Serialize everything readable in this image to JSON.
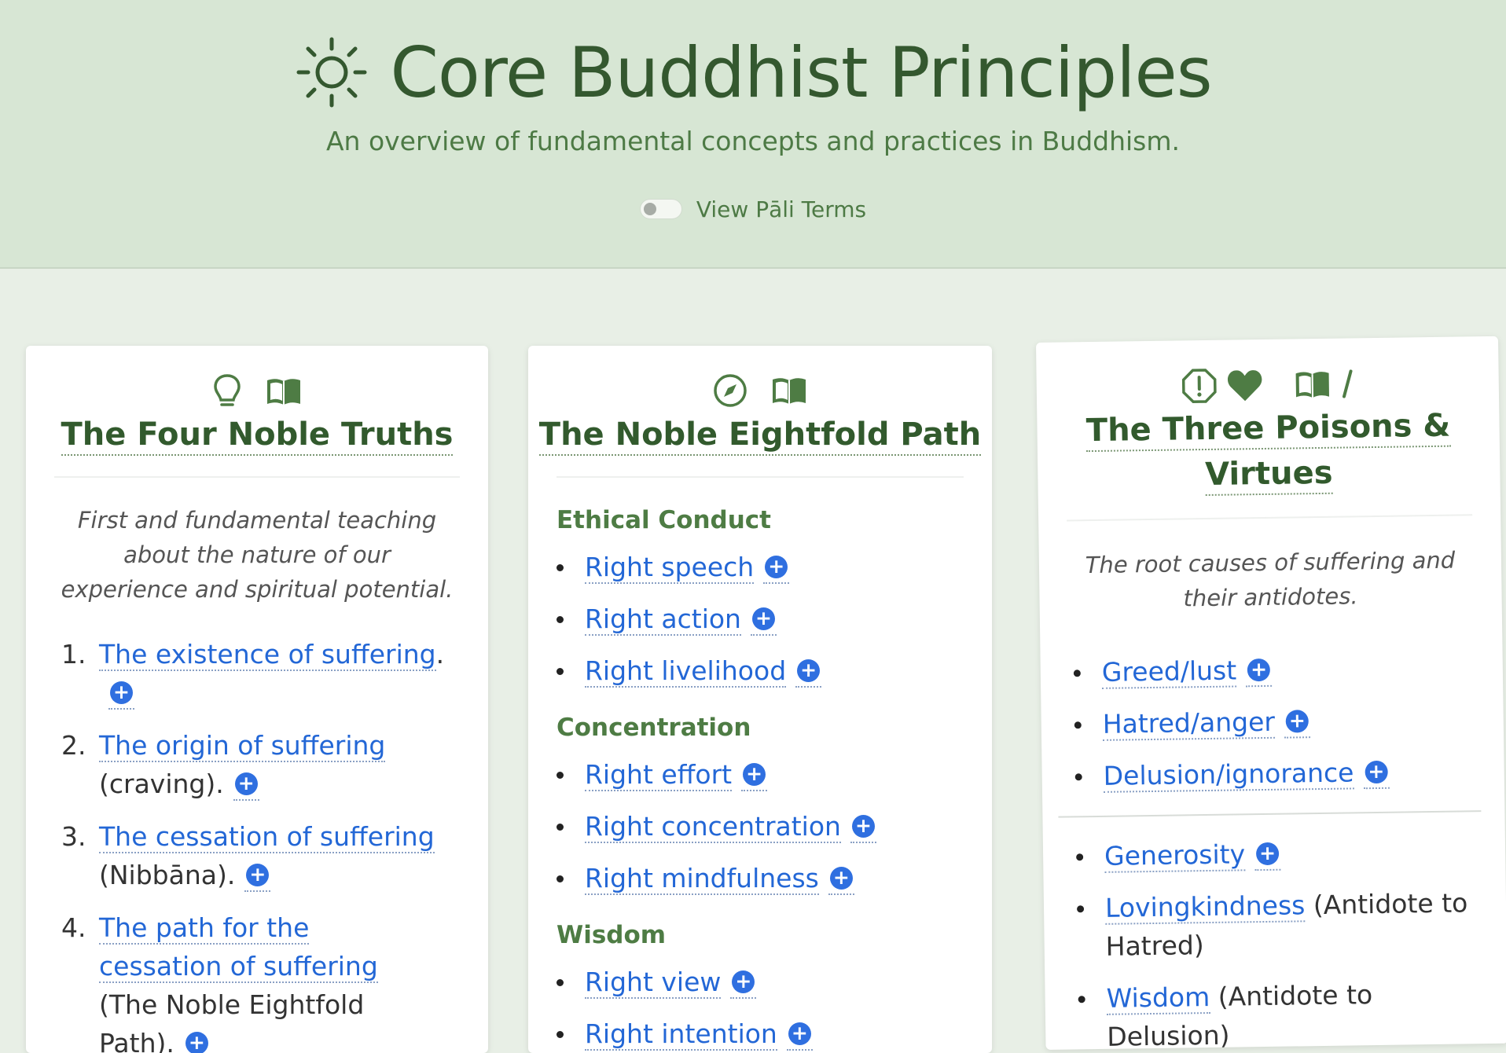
{
  "header": {
    "title": "Core Buddhist Principles",
    "subtitle": "An overview of fundamental concepts and practices in Buddhism.",
    "toggle_label": "View Pāli Terms",
    "toggle_on": false
  },
  "colors": {
    "header_bg": "#d7e6d4",
    "page_bg": "#e8efe6",
    "title_green": "#34582f",
    "link_blue": "#2367d6",
    "plus_blue": "#2f6fe0"
  },
  "cards": [
    {
      "icons": [
        "lightbulb-icon",
        "book-icon"
      ],
      "title": "The Four Noble Truths",
      "description": "First and fundamental teaching about the nature of our experience and spiritual potential.",
      "items": [
        {
          "num": "1.",
          "link": "The existence of suffering",
          "tail": "."
        },
        {
          "num": "2.",
          "link": "The origin of suffering",
          "tail": "(craving)."
        },
        {
          "num": "3.",
          "link": "The cessation of suffering",
          "tail": "(Nibbāna)."
        },
        {
          "num": "4.",
          "link": "The path for the cessation of suffering",
          "tail": "(The Noble Eightfold Path)."
        }
      ]
    },
    {
      "icons": [
        "compass-icon",
        "book-icon"
      ],
      "title": "The Noble Eightfold Path",
      "sections": [
        {
          "heading": "Ethical Conduct",
          "items": [
            "Right speech",
            "Right action",
            "Right livelihood"
          ]
        },
        {
          "heading": "Concentration",
          "items": [
            "Right effort",
            "Right concentration",
            "Right mindfulness"
          ]
        },
        {
          "heading": "Wisdom",
          "items": [
            "Right view",
            "Right intention"
          ]
        }
      ]
    },
    {
      "icons": [
        "alert-octagon-icon",
        "heart-icon",
        "book-icon",
        "slash-icon"
      ],
      "title_line1": "The Three Poisons &",
      "title_line2": "Virtues",
      "description": "The root causes of suffering and their antidotes.",
      "poisons": [
        "Greed/lust",
        "Hatred/anger",
        "Delusion/ignorance"
      ],
      "virtues": [
        {
          "link": "Generosity",
          "tail": ""
        },
        {
          "link": "Lovingkindness",
          "tail": "(Antidote to Hatred)"
        },
        {
          "link": "Wisdom",
          "tail": "(Antidote to Delusion)"
        }
      ]
    }
  ],
  "plus_symbol": "+"
}
